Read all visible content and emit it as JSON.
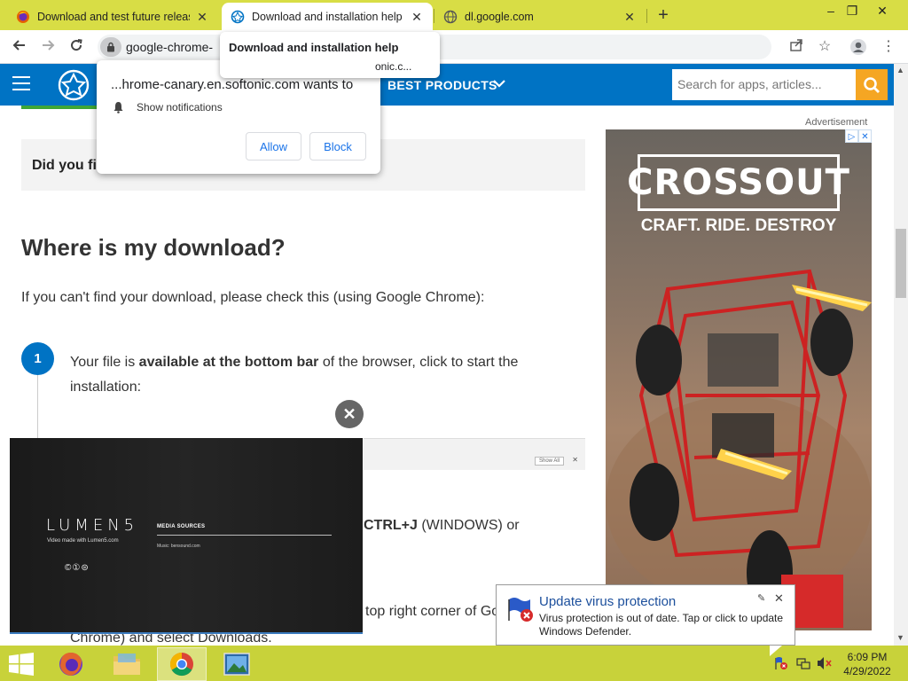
{
  "tabs": [
    {
      "title": "Download and test future releas",
      "active": false,
      "icon": "firefox-icon"
    },
    {
      "title": "Download and installation help",
      "active": true,
      "icon": "softonic-icon"
    },
    {
      "title": "dl.google.com",
      "active": false,
      "icon": "globe-icon"
    }
  ],
  "window_controls": {
    "minimize": "–",
    "restore": "❐",
    "close": "✕"
  },
  "toolbar": {
    "url": "google-chrome-",
    "share_icon": "share-icon",
    "star_icon": "star-icon",
    "profile_icon": "profile-icon",
    "menu_icon": "kebab-menu-icon"
  },
  "hovercard": {
    "title": "Download and installation help",
    "url": "onic.c..."
  },
  "permission_popup": {
    "title": "...hrome-canary.en.softonic.com wants to",
    "item": "Show notifications",
    "allow": "Allow",
    "block": "Block"
  },
  "site_header": {
    "nav_label": "BEST PRODUCTS",
    "search_placeholder": "Search for apps, articles..."
  },
  "page": {
    "callout": "Did you fi",
    "heading": "Where is my download?",
    "intro": "If you can't find your download, please check this (using Google Chrome):",
    "step1_number": "1",
    "step1_pre": "Your file is ",
    "step1_bold": "available at the bottom bar",
    "step1_post": " of the browser, click to start the installation:",
    "download_bar_showall": "Show All",
    "ctrlj_bold": "CTRL+J",
    "ctrlj_rest": " (WINDOWS) or",
    "topright_text": "top right corner of Go",
    "chrome_text": "Chrome) and select Downloads."
  },
  "ad": {
    "label": "Advertisement",
    "title": "CROSSOUT",
    "tagline": "CRAFT. RIDE. DESTROY",
    "accent": "#d62a2a"
  },
  "video": {
    "brand": "LUMEN5",
    "brand_sub": "Video made with Lumen5.com",
    "cc": "©①⊜",
    "media_title": "MEDIA SOURCES",
    "music": "Music: bensound.com"
  },
  "notification": {
    "title": "Update virus protection",
    "body": "Virus protection is out of date. Tap or click to update Windows Defender."
  },
  "clock": {
    "time": "6:09 PM",
    "date": "4/29/2022"
  },
  "colors": {
    "brand_blue": "#0073c4",
    "search_orange": "#f5a623",
    "chrome_frame": "#d8dd45",
    "taskbar": "#c8d23a"
  }
}
